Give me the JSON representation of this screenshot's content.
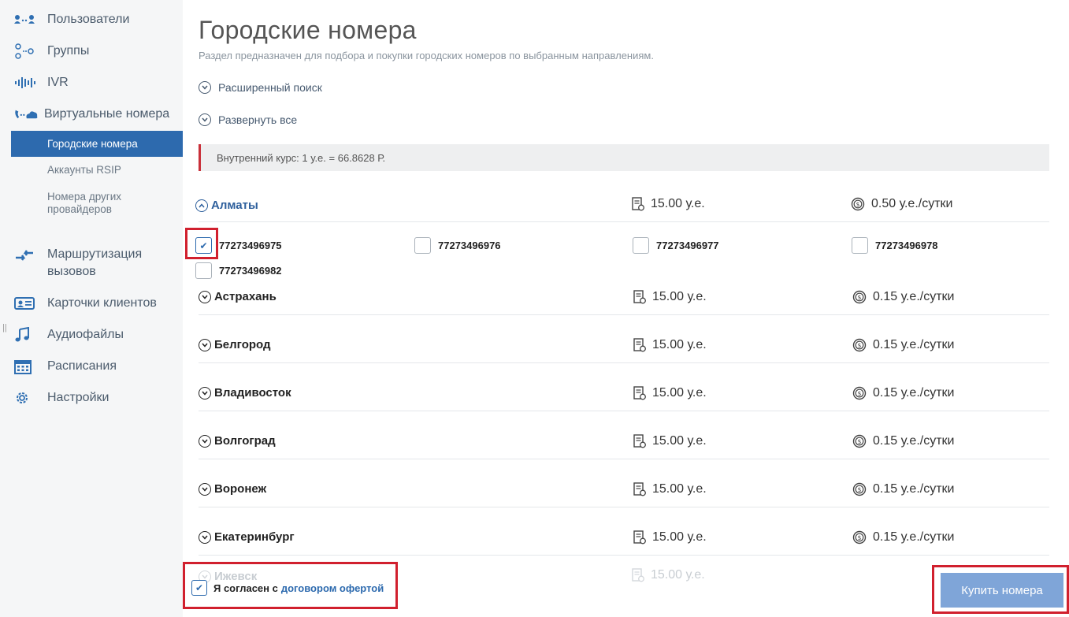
{
  "sidebar": {
    "items": [
      {
        "label": "Пользователи",
        "icon": "users-icon"
      },
      {
        "label": "Группы",
        "icon": "groups-icon"
      },
      {
        "label": "IVR",
        "icon": "ivr-icon"
      },
      {
        "label": "Виртуальные номера",
        "icon": "virtual-numbers-icon"
      },
      {
        "label": "Маршрутизация вызовов",
        "icon": "routing-icon"
      },
      {
        "label": "Карточки клиентов",
        "icon": "client-card-icon"
      },
      {
        "label": "Аудиофайлы",
        "icon": "music-note-icon"
      },
      {
        "label": "Расписания",
        "icon": "calendar-icon"
      },
      {
        "label": "Настройки",
        "icon": "gear-icon"
      }
    ],
    "subitems": [
      {
        "label": "Городские номера",
        "active": true
      },
      {
        "label": "Аккаунты RSIP"
      },
      {
        "label": "Номера других провайдеров"
      }
    ]
  },
  "main": {
    "title": "Городские номера",
    "description": "Раздел предназначен для подбора и покупки городских номеров по выбранным направлениям.",
    "advanced_search": "Расширенный поиск",
    "expand_all": "Развернуть все",
    "rate": "Внутренний курс: 1 у.е. = 66.8628 Р.",
    "cities": [
      {
        "name": "Алматы",
        "price": "15.00 у.е.",
        "daily": "0.50 у.е./сутки",
        "expanded": true
      },
      {
        "name": "Астрахань",
        "price": "15.00 у.е.",
        "daily": "0.15 у.е./сутки"
      },
      {
        "name": "Белгород",
        "price": "15.00 у.е.",
        "daily": "0.15 у.е./сутки"
      },
      {
        "name": "Владивосток",
        "price": "15.00 у.е.",
        "daily": "0.15 у.е./сутки"
      },
      {
        "name": "Волгоград",
        "price": "15.00 у.е.",
        "daily": "0.15 у.е./сутки"
      },
      {
        "name": "Воронеж",
        "price": "15.00 у.е.",
        "daily": "0.15 у.е./сутки"
      },
      {
        "name": "Екатеринбург",
        "price": "15.00 у.е.",
        "daily": "0.15 у.е./сутки"
      },
      {
        "name": "Ижевск",
        "price": "15.00 у.е."
      }
    ],
    "numbers": [
      {
        "number": "77273496975",
        "checked": true
      },
      {
        "number": "77273496976",
        "checked": false
      },
      {
        "number": "77273496977",
        "checked": false
      },
      {
        "number": "77273496978",
        "checked": false
      },
      {
        "number": "77273496982",
        "checked": false
      }
    ],
    "agree_text": "Я согласен с",
    "agree_link": "договором офертой",
    "buy_button": "Купить номера"
  },
  "colors": {
    "accent": "#2d6aae",
    "highlight": "#d1202e",
    "button": "#7fa5d8"
  }
}
